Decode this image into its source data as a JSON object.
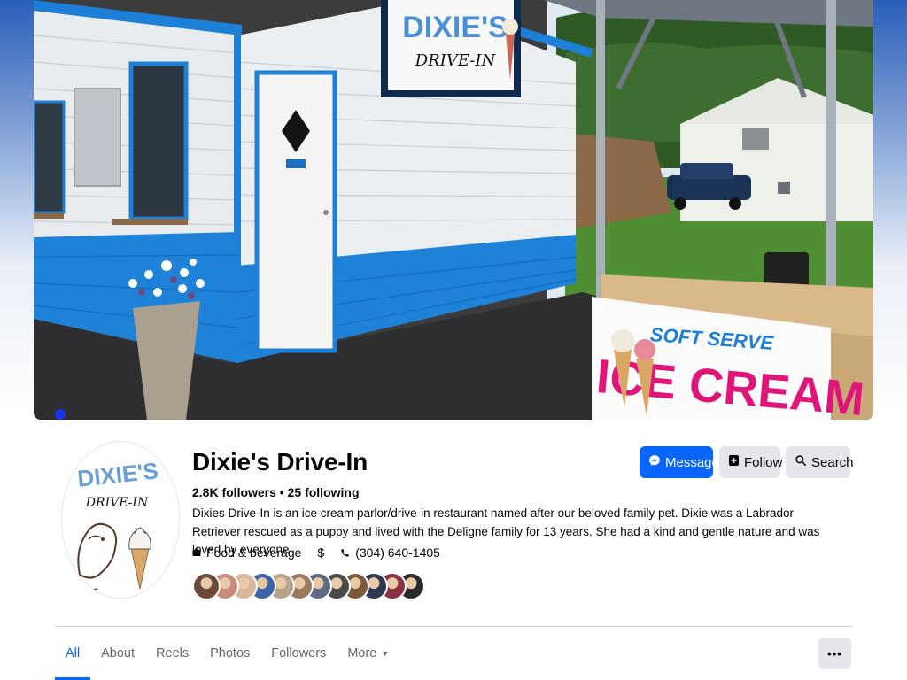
{
  "cover": {
    "sign": {
      "brand": "DIXIE'S",
      "sub": "DRIVE-IN"
    },
    "banner": {
      "line1": "SOFT SERVE",
      "line2": "ICE CREAM"
    }
  },
  "avatar": {
    "brand": "DIXIE'S",
    "sub": "DRIVE-IN"
  },
  "profile": {
    "name": "Dixie's Drive-In",
    "followers": "2.8K followers",
    "separator": " • ",
    "following": "25 following",
    "bio": "Dixies Drive-In is an ice cream parlor/drive-in restaurant named after our beloved family pet. Dixie was a Labrador Retriever rescued as a puppy and lived with the Deligne family for 13 years. She had a kind and gentle nature and was loved by everyone.",
    "category": "Food & beverage",
    "price": "$",
    "phone": "(304) 640-1405"
  },
  "actions": {
    "message": "Message",
    "follow": "Follow",
    "search": "Search"
  },
  "friend_avatars": [
    {
      "color": "#6b4a3a"
    },
    {
      "color": "#c98c7a"
    },
    {
      "color": "#d8b89a"
    },
    {
      "color": "#3b63a8"
    },
    {
      "color": "#b7a38c"
    },
    {
      "color": "#9a7b62"
    },
    {
      "color": "#5b6c84"
    },
    {
      "color": "#4a4a4a"
    },
    {
      "color": "#7a5a3a"
    },
    {
      "color": "#2f3a52"
    },
    {
      "color": "#8a3040"
    },
    {
      "color": "#2a2a2a"
    }
  ],
  "tabs": [
    {
      "label": "All",
      "active": true
    },
    {
      "label": "About"
    },
    {
      "label": "Reels"
    },
    {
      "label": "Photos"
    },
    {
      "label": "Followers"
    },
    {
      "label": "More"
    }
  ],
  "more_button": "•••",
  "colors": {
    "accent": "#0866ff",
    "button_gray": "#e4e6eb",
    "building_blue": "#1e7fd6",
    "ice_cream_pink": "#e0157a"
  }
}
